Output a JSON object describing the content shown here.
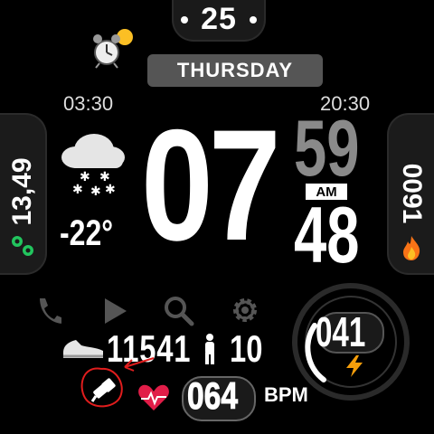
{
  "date": {
    "day_number": "25",
    "weekday": "THURSDAY"
  },
  "sun": {
    "sunrise": "03:30",
    "sunset": "20:30"
  },
  "time": {
    "hour": "07",
    "minute": "59",
    "second": "48",
    "ampm": "AM"
  },
  "weather": {
    "temperature": "-22°",
    "icon": "snow-cloud-icon"
  },
  "left_complication": {
    "value": "13,49",
    "icon": "location-pins-icon",
    "color": "#22c55e"
  },
  "right_complication": {
    "value": "0091",
    "icon": "flame-icon",
    "color": "#f97316"
  },
  "shortcuts": [
    "phone-icon",
    "play-icon",
    "search-icon",
    "gear-icon"
  ],
  "activity": {
    "steps": "11541",
    "floors": "10"
  },
  "heart": {
    "bpm": "064",
    "unit": "BPM"
  },
  "ring": {
    "value": "041",
    "progress": 0.7
  },
  "colors": {
    "annotation": "#e11d1d",
    "heart": "#e11d48",
    "bolt": "#f59e0b",
    "sun": "#fbbf24"
  }
}
